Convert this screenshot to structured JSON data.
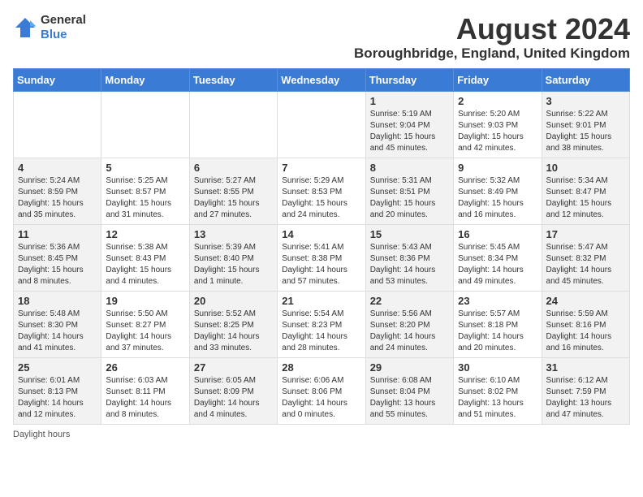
{
  "header": {
    "logo_general": "General",
    "logo_blue": "Blue",
    "main_title": "August 2024",
    "subtitle": "Boroughbridge, England, United Kingdom"
  },
  "columns": [
    "Sunday",
    "Monday",
    "Tuesday",
    "Wednesday",
    "Thursday",
    "Friday",
    "Saturday"
  ],
  "weeks": [
    [
      {
        "day": "",
        "info": ""
      },
      {
        "day": "",
        "info": ""
      },
      {
        "day": "",
        "info": ""
      },
      {
        "day": "",
        "info": ""
      },
      {
        "day": "1",
        "info": "Sunrise: 5:19 AM\nSunset: 9:04 PM\nDaylight: 15 hours and 45 minutes."
      },
      {
        "day": "2",
        "info": "Sunrise: 5:20 AM\nSunset: 9:03 PM\nDaylight: 15 hours and 42 minutes."
      },
      {
        "day": "3",
        "info": "Sunrise: 5:22 AM\nSunset: 9:01 PM\nDaylight: 15 hours and 38 minutes."
      }
    ],
    [
      {
        "day": "4",
        "info": "Sunrise: 5:24 AM\nSunset: 8:59 PM\nDaylight: 15 hours and 35 minutes."
      },
      {
        "day": "5",
        "info": "Sunrise: 5:25 AM\nSunset: 8:57 PM\nDaylight: 15 hours and 31 minutes."
      },
      {
        "day": "6",
        "info": "Sunrise: 5:27 AM\nSunset: 8:55 PM\nDaylight: 15 hours and 27 minutes."
      },
      {
        "day": "7",
        "info": "Sunrise: 5:29 AM\nSunset: 8:53 PM\nDaylight: 15 hours and 24 minutes."
      },
      {
        "day": "8",
        "info": "Sunrise: 5:31 AM\nSunset: 8:51 PM\nDaylight: 15 hours and 20 minutes."
      },
      {
        "day": "9",
        "info": "Sunrise: 5:32 AM\nSunset: 8:49 PM\nDaylight: 15 hours and 16 minutes."
      },
      {
        "day": "10",
        "info": "Sunrise: 5:34 AM\nSunset: 8:47 PM\nDaylight: 15 hours and 12 minutes."
      }
    ],
    [
      {
        "day": "11",
        "info": "Sunrise: 5:36 AM\nSunset: 8:45 PM\nDaylight: 15 hours and 8 minutes."
      },
      {
        "day": "12",
        "info": "Sunrise: 5:38 AM\nSunset: 8:43 PM\nDaylight: 15 hours and 4 minutes."
      },
      {
        "day": "13",
        "info": "Sunrise: 5:39 AM\nSunset: 8:40 PM\nDaylight: 15 hours and 1 minute."
      },
      {
        "day": "14",
        "info": "Sunrise: 5:41 AM\nSunset: 8:38 PM\nDaylight: 14 hours and 57 minutes."
      },
      {
        "day": "15",
        "info": "Sunrise: 5:43 AM\nSunset: 8:36 PM\nDaylight: 14 hours and 53 minutes."
      },
      {
        "day": "16",
        "info": "Sunrise: 5:45 AM\nSunset: 8:34 PM\nDaylight: 14 hours and 49 minutes."
      },
      {
        "day": "17",
        "info": "Sunrise: 5:47 AM\nSunset: 8:32 PM\nDaylight: 14 hours and 45 minutes."
      }
    ],
    [
      {
        "day": "18",
        "info": "Sunrise: 5:48 AM\nSunset: 8:30 PM\nDaylight: 14 hours and 41 minutes."
      },
      {
        "day": "19",
        "info": "Sunrise: 5:50 AM\nSunset: 8:27 PM\nDaylight: 14 hours and 37 minutes."
      },
      {
        "day": "20",
        "info": "Sunrise: 5:52 AM\nSunset: 8:25 PM\nDaylight: 14 hours and 33 minutes."
      },
      {
        "day": "21",
        "info": "Sunrise: 5:54 AM\nSunset: 8:23 PM\nDaylight: 14 hours and 28 minutes."
      },
      {
        "day": "22",
        "info": "Sunrise: 5:56 AM\nSunset: 8:20 PM\nDaylight: 14 hours and 24 minutes."
      },
      {
        "day": "23",
        "info": "Sunrise: 5:57 AM\nSunset: 8:18 PM\nDaylight: 14 hours and 20 minutes."
      },
      {
        "day": "24",
        "info": "Sunrise: 5:59 AM\nSunset: 8:16 PM\nDaylight: 14 hours and 16 minutes."
      }
    ],
    [
      {
        "day": "25",
        "info": "Sunrise: 6:01 AM\nSunset: 8:13 PM\nDaylight: 14 hours and 12 minutes."
      },
      {
        "day": "26",
        "info": "Sunrise: 6:03 AM\nSunset: 8:11 PM\nDaylight: 14 hours and 8 minutes."
      },
      {
        "day": "27",
        "info": "Sunrise: 6:05 AM\nSunset: 8:09 PM\nDaylight: 14 hours and 4 minutes."
      },
      {
        "day": "28",
        "info": "Sunrise: 6:06 AM\nSunset: 8:06 PM\nDaylight: 14 hours and 0 minutes."
      },
      {
        "day": "29",
        "info": "Sunrise: 6:08 AM\nSunset: 8:04 PM\nDaylight: 13 hours and 55 minutes."
      },
      {
        "day": "30",
        "info": "Sunrise: 6:10 AM\nSunset: 8:02 PM\nDaylight: 13 hours and 51 minutes."
      },
      {
        "day": "31",
        "info": "Sunrise: 6:12 AM\nSunset: 7:59 PM\nDaylight: 13 hours and 47 minutes."
      }
    ]
  ],
  "footer": {
    "daylight_label": "Daylight hours"
  }
}
